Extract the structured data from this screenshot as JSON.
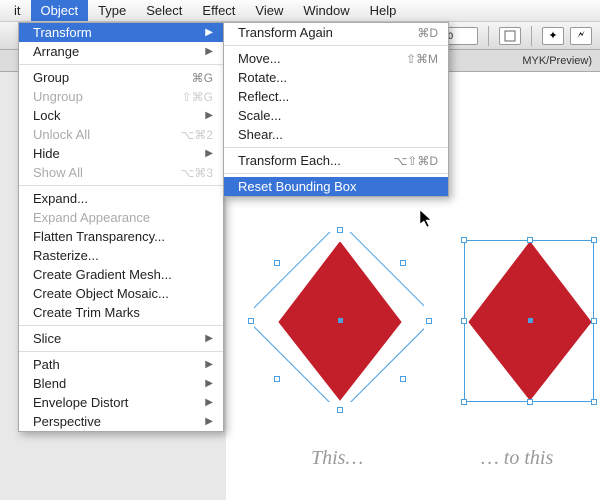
{
  "menubar": {
    "items": [
      "it",
      "Object",
      "Type",
      "Select",
      "Effect",
      "View",
      "Window",
      "Help"
    ],
    "selected_index": 1
  },
  "doc": {
    "label_suffix": "MYK/Preview)"
  },
  "dropdown": {
    "items": [
      {
        "label": "Transform",
        "arrow": true,
        "highlighted": true
      },
      {
        "label": "Arrange",
        "arrow": true
      },
      {
        "sep": true
      },
      {
        "label": "Group",
        "shortcut": "⌘G"
      },
      {
        "label": "Ungroup",
        "shortcut": "⇧⌘G",
        "disabled": true
      },
      {
        "label": "Lock",
        "arrow": true
      },
      {
        "label": "Unlock All",
        "shortcut": "⌥⌘2",
        "disabled": true
      },
      {
        "label": "Hide",
        "arrow": true
      },
      {
        "label": "Show All",
        "shortcut": "⌥⌘3",
        "disabled": true
      },
      {
        "sep": true
      },
      {
        "label": "Expand..."
      },
      {
        "label": "Expand Appearance",
        "disabled": true
      },
      {
        "label": "Flatten Transparency..."
      },
      {
        "label": "Rasterize..."
      },
      {
        "label": "Create Gradient Mesh..."
      },
      {
        "label": "Create Object Mosaic..."
      },
      {
        "label": "Create Trim Marks"
      },
      {
        "sep": true
      },
      {
        "label": "Slice",
        "arrow": true
      },
      {
        "sep": true
      },
      {
        "label": "Path",
        "arrow": true
      },
      {
        "label": "Blend",
        "arrow": true
      },
      {
        "label": "Envelope Distort",
        "arrow": true
      },
      {
        "label": "Perspective",
        "arrow": true
      }
    ]
  },
  "submenu": {
    "items": [
      {
        "label": "Transform Again",
        "shortcut": "⌘D"
      },
      {
        "sep": true
      },
      {
        "label": "Move...",
        "shortcut": "⇧⌘M"
      },
      {
        "label": "Rotate..."
      },
      {
        "label": "Reflect..."
      },
      {
        "label": "Scale..."
      },
      {
        "label": "Shear..."
      },
      {
        "sep": true
      },
      {
        "label": "Transform Each...",
        "shortcut": "⌥⇧⌘D"
      },
      {
        "sep": true
      },
      {
        "label": "Reset Bounding Box",
        "highlighted": true
      }
    ]
  },
  "captions": {
    "left": "This…",
    "right": "… to this"
  }
}
